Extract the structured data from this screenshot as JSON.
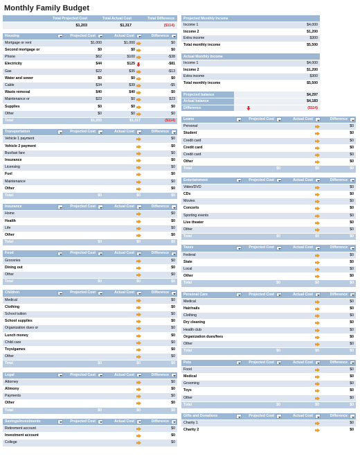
{
  "page_title": "Monthly Family Budget",
  "summary": {
    "headers": [
      "Total Projected Cost",
      "Total Actual Cost",
      "Total Difference"
    ],
    "values": [
      "$1,203",
      "$1,317",
      "($114)"
    ],
    "difference_negative": true
  },
  "column_headers": [
    "Projected Cost",
    "Actual Cost",
    "Difference"
  ],
  "total_label": "Total",
  "icons": {
    "filter": "filter-dropdown-icon",
    "flat": "flat-arrow-icon",
    "down": "down-arrow-icon"
  },
  "colors": {
    "header_blue": "#9bb7d4",
    "row_alt": "#dce4ef",
    "total_blue": "#b9cbe0",
    "negative_red": "#d42b2b",
    "arrow_orange": "#f0a01e",
    "arrow_red": "#e03434"
  },
  "income_projected": {
    "title": "Projected Monthly Income",
    "rows": [
      {
        "label": "Income 1",
        "value": "$4,000"
      },
      {
        "label": "Income 2",
        "value": "$1,200"
      },
      {
        "label": "Extra income",
        "value": "$300"
      },
      {
        "label": "Total monthly income",
        "value": "$5,500"
      }
    ]
  },
  "income_actual": {
    "title": "Actual Monthly Income",
    "rows": [
      {
        "label": "Income 1",
        "value": "$4,000"
      },
      {
        "label": "Income 2",
        "value": "$1,200"
      },
      {
        "label": "Extra income",
        "value": "$300"
      },
      {
        "label": "Total monthly income",
        "value": "$5,500"
      }
    ]
  },
  "balance": {
    "rows": [
      {
        "label": "Projected balance",
        "value": "$4,297",
        "arrow": "none",
        "negative": false
      },
      {
        "label": "Actual balance",
        "value": "$4,183",
        "arrow": "none",
        "negative": false
      },
      {
        "label": "Difference",
        "value": "($114)",
        "arrow": "down",
        "negative": true
      }
    ]
  },
  "tables_left": [
    {
      "name": "Housing",
      "rows": [
        {
          "label": "Mortgage or rent",
          "projected": "$1,000",
          "actual": "$1,000",
          "difference": "$0",
          "arrow": "flat"
        },
        {
          "label": "Second mortgage or",
          "projected": "$0",
          "actual": "$0",
          "difference": "$0",
          "arrow": "flat"
        },
        {
          "label": "Phone",
          "projected": "$62",
          "actual": "$100",
          "difference": "-$38",
          "arrow": "flat"
        },
        {
          "label": "Electricity",
          "projected": "$44",
          "actual": "$125",
          "difference": "-$81",
          "arrow": "down"
        },
        {
          "label": "Gas",
          "projected": "$22",
          "actual": "$35",
          "difference": "-$13",
          "arrow": "flat"
        },
        {
          "label": "Water and sewer",
          "projected": "$0",
          "actual": "$0",
          "difference": "$0",
          "arrow": "flat"
        },
        {
          "label": "Cable",
          "projected": "$34",
          "actual": "$39",
          "difference": "-$5",
          "arrow": "flat"
        },
        {
          "label": "Waste removal",
          "projected": "$40",
          "actual": "$40",
          "difference": "$0",
          "arrow": "flat"
        },
        {
          "label": "Maintenance or",
          "projected": "$23",
          "actual": "$0",
          "difference": "$23",
          "arrow": "flat"
        },
        {
          "label": "Supplies",
          "projected": "$0",
          "actual": "$0",
          "difference": "$0",
          "arrow": "flat"
        },
        {
          "label": "Other",
          "projected": "$0",
          "actual": "$0",
          "difference": "$0",
          "arrow": "flat"
        }
      ],
      "total": {
        "projected": "$1,203",
        "actual": "$1,317",
        "difference": "($114)",
        "difference_negative": true
      }
    },
    {
      "name": "Transportation",
      "rows": [
        {
          "label": "Vehicle 1 payment",
          "projected": "",
          "actual": "",
          "difference": "$0",
          "arrow": "flat"
        },
        {
          "label": "Vehicle 2 payment",
          "projected": "",
          "actual": "",
          "difference": "$0",
          "arrow": "flat"
        },
        {
          "label": "Bus/taxi fare",
          "projected": "",
          "actual": "",
          "difference": "$0",
          "arrow": "flat"
        },
        {
          "label": "Insurance",
          "projected": "",
          "actual": "",
          "difference": "$0",
          "arrow": "flat"
        },
        {
          "label": "Licensing",
          "projected": "",
          "actual": "",
          "difference": "$0",
          "arrow": "flat"
        },
        {
          "label": "Fuel",
          "projected": "",
          "actual": "",
          "difference": "$0",
          "arrow": "flat"
        },
        {
          "label": "Maintenance",
          "projected": "",
          "actual": "",
          "difference": "$0",
          "arrow": "flat"
        },
        {
          "label": "Other",
          "projected": "",
          "actual": "",
          "difference": "$0",
          "arrow": "flat"
        }
      ],
      "total": {
        "projected": "$0",
        "actual": "$0",
        "difference": "$0",
        "difference_negative": false
      }
    },
    {
      "name": "Insurance",
      "rows": [
        {
          "label": "Home",
          "projected": "",
          "actual": "",
          "difference": "$0",
          "arrow": "flat"
        },
        {
          "label": "Health",
          "projected": "",
          "actual": "",
          "difference": "$0",
          "arrow": "flat"
        },
        {
          "label": "Life",
          "projected": "",
          "actual": "",
          "difference": "$0",
          "arrow": "flat"
        },
        {
          "label": "Other",
          "projected": "",
          "actual": "",
          "difference": "$0",
          "arrow": "flat"
        }
      ],
      "total": {
        "projected": "$0",
        "actual": "$0",
        "difference": "$0",
        "difference_negative": false
      }
    },
    {
      "name": "Food",
      "rows": [
        {
          "label": "Groceries",
          "projected": "",
          "actual": "",
          "difference": "$0",
          "arrow": "flat"
        },
        {
          "label": "Dining out",
          "projected": "",
          "actual": "",
          "difference": "$0",
          "arrow": "flat"
        },
        {
          "label": "Other",
          "projected": "",
          "actual": "",
          "difference": "$0",
          "arrow": "flat"
        }
      ],
      "total": {
        "projected": "$0",
        "actual": "$0",
        "difference": "$0",
        "difference_negative": false
      }
    },
    {
      "name": "Children",
      "rows": [
        {
          "label": "Medical",
          "projected": "",
          "actual": "",
          "difference": "$0",
          "arrow": "flat"
        },
        {
          "label": "Clothing",
          "projected": "",
          "actual": "",
          "difference": "$0",
          "arrow": "flat"
        },
        {
          "label": "School tuition",
          "projected": "",
          "actual": "",
          "difference": "$0",
          "arrow": "flat"
        },
        {
          "label": "School supplies",
          "projected": "",
          "actual": "",
          "difference": "$0",
          "arrow": "flat"
        },
        {
          "label": "Organization dues or",
          "projected": "",
          "actual": "",
          "difference": "$0",
          "arrow": "flat"
        },
        {
          "label": "Lunch money",
          "projected": "",
          "actual": "",
          "difference": "$0",
          "arrow": "flat"
        },
        {
          "label": "Child care",
          "projected": "",
          "actual": "",
          "difference": "$0",
          "arrow": "flat"
        },
        {
          "label": "Toys/games",
          "projected": "",
          "actual": "",
          "difference": "$0",
          "arrow": "flat"
        },
        {
          "label": "Other",
          "projected": "",
          "actual": "",
          "difference": "$0",
          "arrow": "flat"
        }
      ],
      "total": {
        "projected": "$0",
        "actual": "$0",
        "difference": "$0",
        "difference_negative": false
      }
    },
    {
      "name": "Legal",
      "rows": [
        {
          "label": "Attorney",
          "projected": "",
          "actual": "",
          "difference": "$0",
          "arrow": "flat"
        },
        {
          "label": "Alimony",
          "projected": "",
          "actual": "",
          "difference": "$0",
          "arrow": "flat"
        },
        {
          "label": "Payments",
          "projected": "",
          "actual": "",
          "difference": "$0",
          "arrow": "flat"
        },
        {
          "label": "Other",
          "projected": "",
          "actual": "",
          "difference": "$0",
          "arrow": "flat"
        }
      ],
      "total": {
        "projected": "$0",
        "actual": "$0",
        "difference": "$0",
        "difference_negative": false
      }
    },
    {
      "name": "Savings/Investments",
      "rows": [
        {
          "label": "Retirement account",
          "projected": "",
          "actual": "",
          "difference": "$0",
          "arrow": "flat"
        },
        {
          "label": "Investment account",
          "projected": "",
          "actual": "",
          "difference": "$0",
          "arrow": "flat"
        },
        {
          "label": "College",
          "projected": "",
          "actual": "",
          "difference": "$0",
          "arrow": "flat"
        }
      ],
      "total": null
    }
  ],
  "tables_right": [
    {
      "name": "Loans",
      "rows": [
        {
          "label": "Personal",
          "projected": "",
          "actual": "",
          "difference": "$0",
          "arrow": "flat"
        },
        {
          "label": "Student",
          "projected": "",
          "actual": "",
          "difference": "$0",
          "arrow": "flat"
        },
        {
          "label": "Credit card",
          "projected": "",
          "actual": "",
          "difference": "$0",
          "arrow": "flat"
        },
        {
          "label": "Credit card",
          "projected": "",
          "actual": "",
          "difference": "$0",
          "arrow": "flat"
        },
        {
          "label": "Credit card",
          "projected": "",
          "actual": "",
          "difference": "$0",
          "arrow": "flat"
        },
        {
          "label": "Other",
          "projected": "",
          "actual": "",
          "difference": "$0",
          "arrow": "flat"
        }
      ],
      "total": {
        "projected": "$0",
        "actual": "$0",
        "difference": "$0",
        "difference_negative": false
      }
    },
    {
      "name": "Entertainment",
      "rows": [
        {
          "label": "Video/DVD",
          "projected": "",
          "actual": "",
          "difference": "$0",
          "arrow": "flat"
        },
        {
          "label": "CDs",
          "projected": "",
          "actual": "",
          "difference": "$0",
          "arrow": "flat"
        },
        {
          "label": "Movies",
          "projected": "",
          "actual": "",
          "difference": "$0",
          "arrow": "flat"
        },
        {
          "label": "Concerts",
          "projected": "",
          "actual": "",
          "difference": "$0",
          "arrow": "flat"
        },
        {
          "label": "Sporting events",
          "projected": "",
          "actual": "",
          "difference": "$0",
          "arrow": "flat"
        },
        {
          "label": "Live theater",
          "projected": "",
          "actual": "",
          "difference": "$0",
          "arrow": "flat"
        },
        {
          "label": "Other",
          "projected": "",
          "actual": "",
          "difference": "$0",
          "arrow": "flat"
        }
      ],
      "total": {
        "projected": "$0",
        "actual": "$0",
        "difference": "$0",
        "difference_negative": false
      }
    },
    {
      "name": "Taxes",
      "rows": [
        {
          "label": "Federal",
          "projected": "",
          "actual": "",
          "difference": "$0",
          "arrow": "flat"
        },
        {
          "label": "State",
          "projected": "",
          "actual": "",
          "difference": "$0",
          "arrow": "flat"
        },
        {
          "label": "Local",
          "projected": "",
          "actual": "",
          "difference": "$0",
          "arrow": "flat"
        },
        {
          "label": "Other",
          "projected": "",
          "actual": "",
          "difference": "$0",
          "arrow": "flat"
        }
      ],
      "total": {
        "projected": "$0",
        "actual": "$0",
        "difference": "$0",
        "difference_negative": false
      }
    },
    {
      "name": "Personal Care",
      "rows": [
        {
          "label": "Medical",
          "projected": "",
          "actual": "",
          "difference": "$0",
          "arrow": "flat"
        },
        {
          "label": "Hair/nails",
          "projected": "",
          "actual": "",
          "difference": "$0",
          "arrow": "flat"
        },
        {
          "label": "Clothing",
          "projected": "",
          "actual": "",
          "difference": "$0",
          "arrow": "flat"
        },
        {
          "label": "Dry cleaning",
          "projected": "",
          "actual": "",
          "difference": "$0",
          "arrow": "flat"
        },
        {
          "label": "Health club",
          "projected": "",
          "actual": "",
          "difference": "$0",
          "arrow": "flat"
        },
        {
          "label": "Organization dues/fees",
          "projected": "",
          "actual": "",
          "difference": "$0",
          "arrow": "flat"
        },
        {
          "label": "Other",
          "projected": "",
          "actual": "",
          "difference": "$0",
          "arrow": "flat"
        }
      ],
      "total": {
        "projected": "$0",
        "actual": "$0",
        "difference": "$0",
        "difference_negative": false
      }
    },
    {
      "name": "Pets",
      "rows": [
        {
          "label": "Food",
          "projected": "",
          "actual": "",
          "difference": "$0",
          "arrow": "flat"
        },
        {
          "label": "Medical",
          "projected": "",
          "actual": "",
          "difference": "$0",
          "arrow": "flat"
        },
        {
          "label": "Grooming",
          "projected": "",
          "actual": "",
          "difference": "$0",
          "arrow": "flat"
        },
        {
          "label": "Toys",
          "projected": "",
          "actual": "",
          "difference": "$0",
          "arrow": "flat"
        },
        {
          "label": "Other",
          "projected": "",
          "actual": "",
          "difference": "$0",
          "arrow": "flat"
        }
      ],
      "total": {
        "projected": "$0",
        "actual": "$0",
        "difference": "$0",
        "difference_negative": false
      }
    },
    {
      "name": "Gifts and Donations",
      "rows": [
        {
          "label": "Charity 1",
          "projected": "",
          "actual": "",
          "difference": "$0",
          "arrow": "flat"
        },
        {
          "label": "Charity 2",
          "projected": "",
          "actual": "",
          "difference": "$0",
          "arrow": "flat"
        }
      ],
      "total": null
    }
  ]
}
